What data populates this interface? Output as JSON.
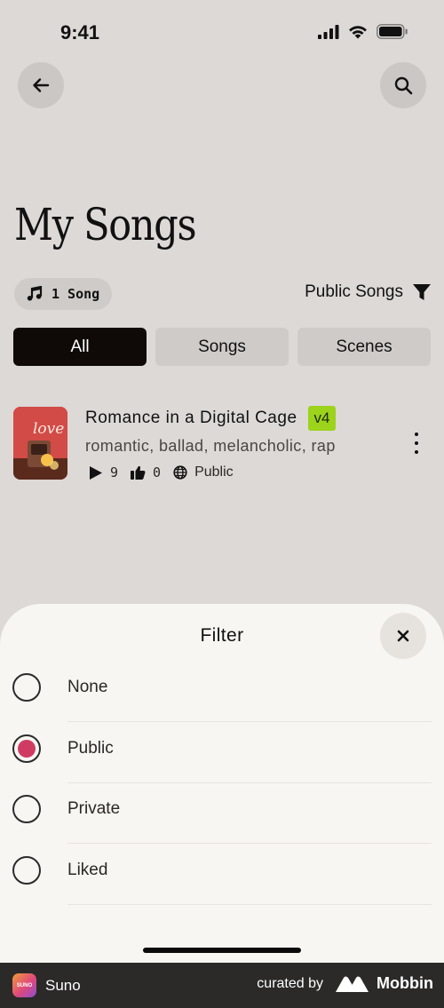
{
  "status_bar": {
    "time": "9:41"
  },
  "header": {
    "title": "My Songs"
  },
  "song_count": {
    "label": "1 Song"
  },
  "filter_link": {
    "label": "Public Songs"
  },
  "tabs": [
    {
      "label": "All",
      "active": true
    },
    {
      "label": "Songs",
      "active": false
    },
    {
      "label": "Scenes",
      "active": false
    }
  ],
  "songs": [
    {
      "title": "Romance in a Digital Cage",
      "version": "v4",
      "tags": "romantic, ballad, melancholic, rap",
      "cover_text": "love",
      "plays": "9",
      "likes": "0",
      "visibility": "Public"
    }
  ],
  "filter_sheet": {
    "title": "Filter",
    "options": [
      {
        "label": "None",
        "selected": false
      },
      {
        "label": "Public",
        "selected": true
      },
      {
        "label": "Private",
        "selected": false
      },
      {
        "label": "Liked",
        "selected": false
      }
    ],
    "selected_color": "#d03b64"
  },
  "footer": {
    "app_name": "Suno",
    "app_icon_text": "SUNO",
    "curated_by": "curated by",
    "brand": "Mobbin"
  },
  "colors": {
    "accent_badge": "#9cd31b",
    "active_tab": "#0f0a08",
    "background": "#dcd9d7",
    "sheet": "#f8f6f2"
  }
}
